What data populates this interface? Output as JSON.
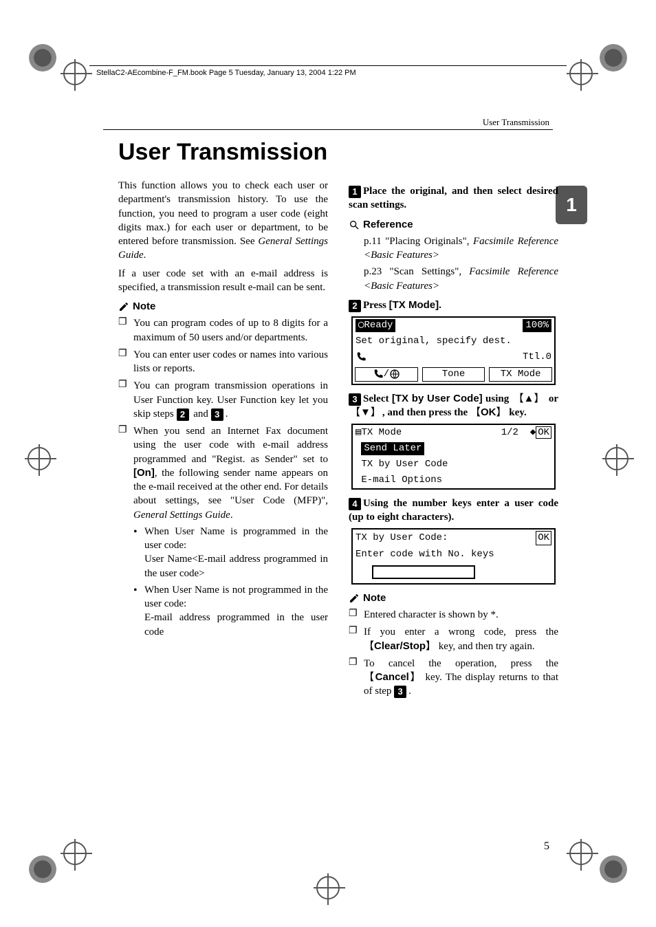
{
  "book_header": "StellaC2-AEcombine-F_FM.book  Page 5  Tuesday, January 13, 2004  1:22 PM",
  "running_header": "User Transmission",
  "chapter_tab": "1",
  "title": "User Transmission",
  "left": {
    "p1": "This function allows you to check each user or department's transmission history. To use the function, you need to program a user code (eight digits max.) for each user or department, to be entered before transmission. See ",
    "p1_italic": "General Settings Guide",
    "p1_end": ".",
    "p2": "If a user code set with an e-mail address is specified, a transmission result e-mail can be sent.",
    "note_title": "Note",
    "notes": {
      "n1": "You can program codes of up to 8 digits for a maximum of 50 users and/or departments.",
      "n2": "You can enter user codes or names into various lists or reports.",
      "n3a": "You can program transmission operations in User Function key. User Function key let you skip steps ",
      "n3b": " and ",
      "n3c": ".",
      "s2": "2",
      "s3": "3",
      "n4a": "When you send an Internet Fax document using the user code with e-mail address programmed and \"Regist. as Sender\" set to ",
      "n4_on": "[On]",
      "n4b": ", the following sender name appears on the e-mail received at the other end. For details about settings, see \"User Code (MFP)\", ",
      "n4_italic": "General Settings Guide",
      "n4c": ".",
      "sub1_a": "When User Name is programmed in the user code:",
      "sub1_b": "User Name<E-mail address programmed in the user code>",
      "sub2_a": "When User Name is not programmed in the user code:",
      "sub2_b": "E-mail address programmed in the user code"
    }
  },
  "right": {
    "step1": {
      "num": "1",
      "text": "Place the original, and then select desired scan settings."
    },
    "ref_title": "Reference",
    "ref1a": "p.11 \"Placing Originals\", ",
    "ref1b": "Facsimile Reference <Basic Features>",
    "ref2a": "p.23 \"Scan Settings\", ",
    "ref2b": "Facsimile Reference <Basic Features>",
    "step2": {
      "num": "2",
      "text_a": "Press ",
      "btn": "[TX Mode]",
      "text_b": "."
    },
    "lcd1": {
      "ready": "Ready",
      "pct": "100%",
      "line2": "Set original, specify dest.",
      "ttl": "Ttl.0",
      "tone": "Tone",
      "tx": "TX Mode"
    },
    "step3": {
      "num": "3",
      "a": "Select ",
      "btn": "[TX by User Code]",
      "b": " using ",
      "up": "▲",
      "c": " or ",
      "dn": "▼",
      "d": ", and then press the ",
      "ok": "OK",
      "e": " key."
    },
    "lcd2": {
      "title": "TX Mode",
      "page": "1/2",
      "ok": "OK",
      "opt1": "Send Later",
      "opt2": "TX by User Code",
      "opt3": "E-mail Options"
    },
    "step4": {
      "num": "4",
      "text": "Using the number keys enter a user code (up to eight characters)."
    },
    "lcd3": {
      "title": "TX by User Code:",
      "ok": "OK",
      "line2": "Enter code with No. keys"
    },
    "note_title": "Note",
    "rnotes": {
      "n1": "Entered character is shown by *.",
      "n2a": "If you enter a wrong code, press the ",
      "n2_key": "Clear/Stop",
      "n2b": " key, and then try again.",
      "n3a": "To cancel the operation, press the ",
      "n3_key": "Cancel",
      "n3b": " key. The display returns to that of step ",
      "n3_step": "3",
      "n3c": "."
    }
  },
  "page_number": "5"
}
